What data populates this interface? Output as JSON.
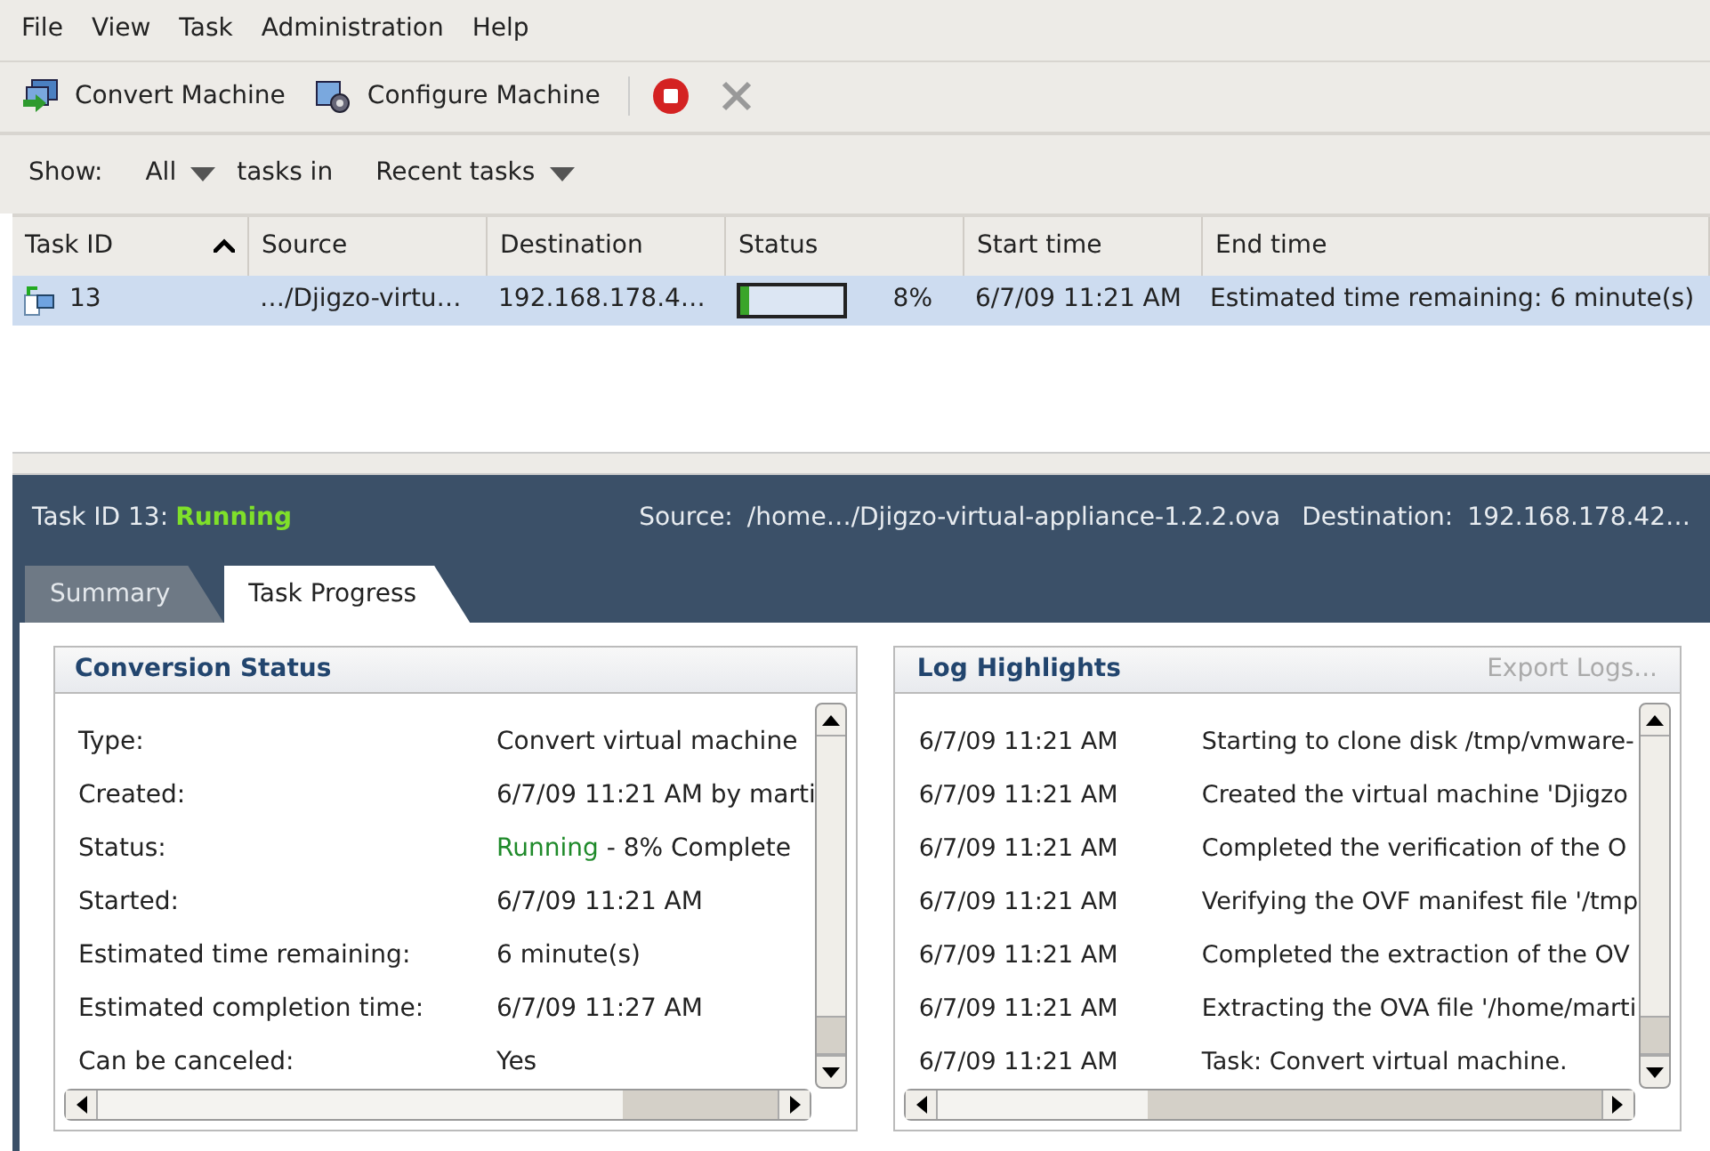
{
  "menu": [
    "File",
    "View",
    "Task",
    "Administration",
    "Help"
  ],
  "toolbar": [
    {
      "label": "Convert Machine",
      "kind": "convert"
    },
    {
      "label": "Configure Machine",
      "kind": "configure"
    },
    {
      "kind": "stop"
    },
    {
      "kind": "cancel",
      "disabled": true
    }
  ],
  "filter": {
    "label": "Show:",
    "scope": "All",
    "middle": "tasks in",
    "range": "Recent tasks"
  },
  "table": {
    "columns": [
      "Task ID",
      "Source",
      "Destination",
      "Status",
      "Start time",
      "End time"
    ],
    "rows": [
      {
        "selected": true,
        "task_id": "13",
        "source": "…/Djigzo-virtu…",
        "destination": "192.168.178.4…",
        "level": 0.08,
        "percent": "8%",
        "start": "6/7/09 11:21 AM",
        "end": "Estimated time remaining: 6 minute(s)"
      }
    ]
  },
  "detail": {
    "title": "Task ID 13:",
    "state": "Running",
    "source_label": "Source:",
    "source": "/home…/Djigzo-virtual-appliance-1.2.2.ova",
    "destination_label": "Destination:",
    "destination": "192.168.178.42…"
  },
  "tabs": [
    {
      "label": "Summary",
      "selected": false
    },
    {
      "label": "Task Progress",
      "selected": true
    }
  ],
  "conversion_status": {
    "title": "Conversion Status",
    "rows": [
      {
        "label": "Type:",
        "value": "Convert virtual machine"
      },
      {
        "label": "Created:",
        "value": "6/7/09 11:21 AM by marti"
      },
      {
        "label": "Status:",
        "value": "Running",
        "suffix": " - 8% Complete"
      },
      {
        "label": "Started:",
        "value": "6/7/09 11:21 AM"
      },
      {
        "label": "Estimated time remaining:",
        "value": "6 minute(s)"
      },
      {
        "label": "Estimated completion time:",
        "value": "6/7/09 11:27 AM"
      },
      {
        "label": "Can be canceled:",
        "value": "Yes"
      }
    ]
  },
  "log": {
    "title": "Log Highlights",
    "export": "Export Logs...",
    "export_disabled": true,
    "rows": [
      {
        "time": "6/7/09 11:21 AM",
        "message": "Starting to clone disk /tmp/vmware-"
      },
      {
        "time": "6/7/09 11:21 AM",
        "message": "Created the virtual machine 'Djigzo"
      },
      {
        "time": "6/7/09 11:21 AM",
        "message": "Completed the verification of the O"
      },
      {
        "time": "6/7/09 11:21 AM",
        "message": "Verifying the OVF manifest file '/tmp"
      },
      {
        "time": "6/7/09 11:21 AM",
        "message": "Completed the extraction of the OV"
      },
      {
        "time": "6/7/09 11:21 AM",
        "message": "Extracting the OVA file '/home/marti"
      },
      {
        "time": "6/7/09 11:21 AM",
        "message": "Task: Convert virtual machine."
      }
    ]
  }
}
